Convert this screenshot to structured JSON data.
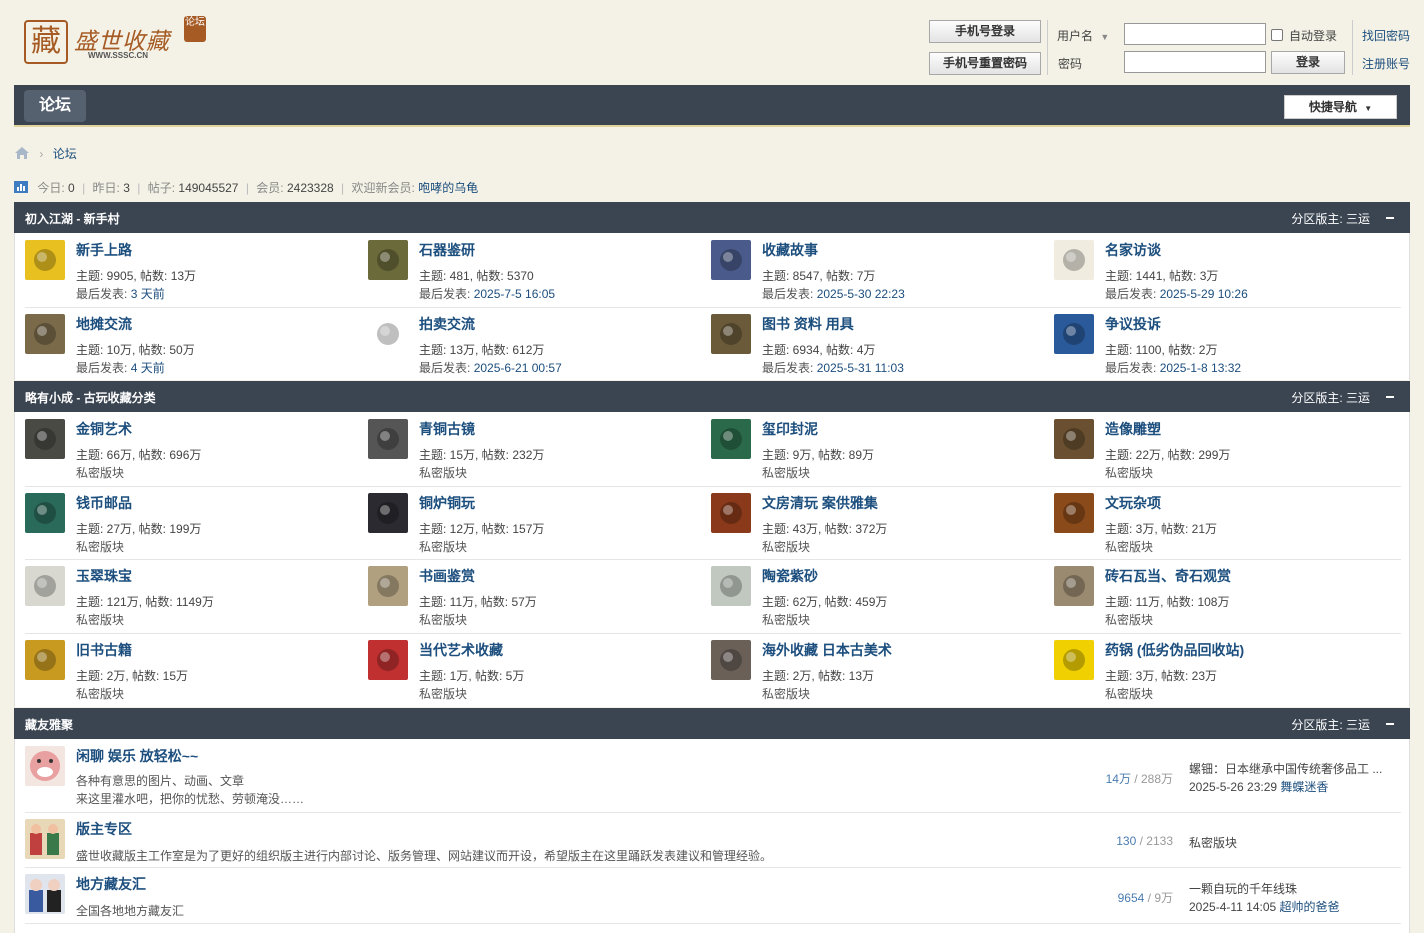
{
  "site": {
    "logo_text": "盛世收藏",
    "logo_seal": "藏",
    "logo_url": "WWW.SSSC.CN",
    "logo_badge": "论坛"
  },
  "login": {
    "phone_login": "手机号登录",
    "phone_reset": "手机号重置密码",
    "username_label": "用户名",
    "password_label": "密码",
    "auto_login": "自动登录",
    "login_button": "登录",
    "forgot_password": "找回密码",
    "register": "注册账号"
  },
  "nav": {
    "forum_tab": "论坛",
    "quick_nav": "快捷导航"
  },
  "breadcrumb": {
    "current": "论坛"
  },
  "stats": {
    "today_label": "今日:",
    "today": "0",
    "yesterday_label": "昨日:",
    "yesterday": "3",
    "posts_label": "帖子:",
    "posts": "149045527",
    "members_label": "会员:",
    "members": "2423328",
    "welcome_label": "欢迎新会员:",
    "newest_member": "咆哮的乌龟"
  },
  "sections": [
    {
      "title": "初入江湖 - 新手村",
      "moderator": "分区版主: 三运",
      "forums": [
        {
          "name": "新手上路",
          "stats": "主题: 9905, 帖数: 13万",
          "last_label": "最后发表:",
          "last": "3 天前",
          "icon": "caution-sign-icon",
          "color": "#e8c020"
        },
        {
          "name": "石器鉴研",
          "stats": "主题: 481, 帖数: 5370",
          "last_label": "最后发表:",
          "last": "2025-7-5 16:05",
          "icon": "stone-artifact-icon",
          "color": "#6a6a3a"
        },
        {
          "name": "收藏故事",
          "stats": "主题: 8547, 帖数: 7万",
          "last_label": "最后发表:",
          "last": "2025-5-30 22:23",
          "icon": "stage-photo-icon",
          "color": "#4a5a8a"
        },
        {
          "name": "名家访谈",
          "stats": "主题: 1441, 帖数: 3万",
          "last_label": "最后发表:",
          "last": "2025-5-29 10:26",
          "icon": "pavilion-icon",
          "color": "#f0ece0"
        },
        {
          "name": "地摊交流",
          "stats": "主题: 10万, 帖数: 50万",
          "last_label": "最后发表:",
          "last": "4 天前",
          "icon": "market-photo-icon",
          "color": "#7a6a4a"
        },
        {
          "name": "拍卖交流",
          "stats": "主题: 13万, 帖数: 612万",
          "last_label": "最后发表:",
          "last": "2025-6-21 00:57",
          "icon": "auction-seal-icon",
          "color": "#ffffff"
        },
        {
          "name": "图书 资料 用具",
          "stats": "主题: 6934, 帖数: 4万",
          "last_label": "最后发表:",
          "last": "2025-5-31 11:03",
          "icon": "books-photo-icon",
          "color": "#6a5a3a"
        },
        {
          "name": "争议投诉",
          "stats": "主题: 1100, 帖数: 2万",
          "last_label": "最后发表:",
          "last": "2025-1-8 13:32",
          "icon": "red-sun-icon",
          "color": "#2a5a9a"
        }
      ]
    },
    {
      "title": "略有小成 - 古玩收藏分类",
      "moderator": "分区版主: 三运",
      "forums": [
        {
          "name": "金铜艺术",
          "stats": "主题: 66万, 帖数: 696万",
          "last": "私密版块",
          "icon": "bronze-vessel-icon",
          "color": "#4a4a44"
        },
        {
          "name": "青铜古镜",
          "stats": "主题: 15万, 帖数: 232万",
          "last": "私密版块",
          "icon": "bronze-mirror-icon",
          "color": "#555555"
        },
        {
          "name": "玺印封泥",
          "stats": "主题: 9万, 帖数: 89万",
          "last": "私密版块",
          "icon": "jade-seal-icon",
          "color": "#2a6a4a"
        },
        {
          "name": "造像雕塑",
          "stats": "主题: 22万, 帖数: 299万",
          "last": "私密版块",
          "icon": "buddha-statue-icon",
          "color": "#6a5030"
        },
        {
          "name": "钱币邮品",
          "stats": "主题: 27万, 帖数: 199万",
          "last": "私密版块",
          "icon": "coin-icon",
          "color": "#2a6a5a"
        },
        {
          "name": "铜炉铜玩",
          "stats": "主题: 12万, 帖数: 157万",
          "last": "私密版块",
          "icon": "incense-burner-icon",
          "color": "#2a2a30"
        },
        {
          "name": "文房清玩 案供雅集",
          "stats": "主题: 43万, 帖数: 372万",
          "last": "私密版块",
          "icon": "gourd-icon",
          "color": "#8a3a1a"
        },
        {
          "name": "文玩杂项",
          "stats": "主题: 3万, 帖数: 21万",
          "last": "私密版块",
          "icon": "beads-icon",
          "color": "#8a4a1a"
        },
        {
          "name": "玉翠珠宝",
          "stats": "主题: 121万, 帖数: 1149万",
          "last": "私密版块",
          "icon": "jade-carving-icon",
          "color": "#d8d8d0"
        },
        {
          "name": "书画鉴赏",
          "stats": "主题: 11万, 帖数: 57万",
          "last": "私密版块",
          "icon": "painting-icon",
          "color": "#b0a080"
        },
        {
          "name": "陶瓷紫砂",
          "stats": "主题: 62万, 帖数: 459万",
          "last": "私密版块",
          "icon": "ceramic-bowl-icon",
          "color": "#c0c8c0"
        },
        {
          "name": "砖石瓦当、奇石观赏",
          "stats": "主题: 11万, 帖数: 108万",
          "last": "私密版块",
          "icon": "tile-end-icon",
          "color": "#9a8a70"
        },
        {
          "name": "旧书古籍",
          "stats": "主题: 2万, 帖数: 15万",
          "last": "私密版块",
          "icon": "old-book-icon",
          "color": "#c89a20"
        },
        {
          "name": "当代艺术收藏",
          "stats": "主题: 1万, 帖数: 5万",
          "last": "私密版块",
          "icon": "portrait-icon",
          "color": "#c03030"
        },
        {
          "name": "海外收藏 日本古美术",
          "stats": "主题: 2万, 帖数: 13万",
          "last": "私密版块",
          "icon": "clock-icon",
          "color": "#6a6058"
        },
        {
          "name": "药锅 (低劣伪品回收站)",
          "stats": "主题: 3万, 帖数: 23万",
          "last": "私密版块",
          "icon": "warning-skull-icon",
          "color": "#f0d000"
        }
      ]
    },
    {
      "title": "藏友雅聚",
      "moderator": "分区版主: 三运",
      "forums": [
        {
          "name": "闲聊 娱乐 放轻松~~",
          "desc": [
            "各种有意思的图片、动画、文章",
            "来这里灌水吧，把你的忧愁、劳顿淹没……"
          ],
          "topics": "14万",
          "posts": "288万",
          "last_title": "螺钿：日本继承中国传统奢侈品工 ...",
          "last_time": "2025-5-26 23:29",
          "last_user": "舞蝶迷香",
          "icon": "laughing-face-icon",
          "color": "#e8a0a0"
        },
        {
          "name": "版主专区",
          "desc": [
            "盛世收藏版主工作室是为了更好的组织版主进行内部讨论、版务管理、网站建议而开设，希望版主在这里踊跃发表建议和管理经验。"
          ],
          "topics": "130",
          "posts": "2133",
          "last_private": "私密版块",
          "icon": "two-figures-icon",
          "color": "#c04040"
        },
        {
          "name": "地方藏友汇",
          "desc": [
            "全国各地地方藏友汇"
          ],
          "topics": "9654",
          "posts": "9万",
          "last_title": "一颗自玩的千年线珠",
          "last_time": "2025-4-11 14:05",
          "last_user": "超帅的爸爸",
          "icon": "opera-figures-icon",
          "color": "#3a5aa0"
        }
      ]
    }
  ]
}
